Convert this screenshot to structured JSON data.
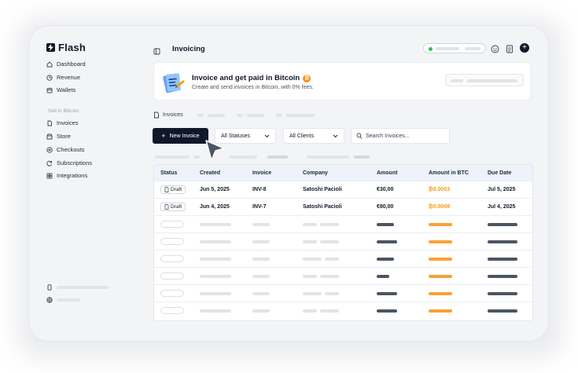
{
  "app": {
    "name": "Flash"
  },
  "sidebar": {
    "items": [
      {
        "label": "Dashboard",
        "icon": "home-icon"
      },
      {
        "label": "Revenue",
        "icon": "clock-icon"
      },
      {
        "label": "Wallets",
        "icon": "wallet-icon"
      }
    ],
    "section_label": "Sell in Bitcoin",
    "sell_items": [
      {
        "label": "Invoices",
        "icon": "invoice-icon"
      },
      {
        "label": "Store",
        "icon": "store-icon"
      },
      {
        "label": "Checkouts",
        "icon": "checkout-icon"
      },
      {
        "label": "Subscriptions",
        "icon": "refresh-icon"
      },
      {
        "label": "Integrations",
        "icon": "grid-icon"
      }
    ]
  },
  "header": {
    "title": "Invoicing"
  },
  "banner": {
    "title": "Invoice and get paid in Bitcoin",
    "subtitle": "Create and send invoices in Bitcoin, with 0% fees.",
    "coin_symbol": "₿"
  },
  "tabs": {
    "active": "Invoices"
  },
  "toolbar": {
    "new_invoice": "New Invoice",
    "status_filter": "All Statuses",
    "client_filter": "All Clients",
    "search_placeholder": "Search Invoices..."
  },
  "table": {
    "columns": [
      "Status",
      "Created",
      "Invoice",
      "Company",
      "Amount",
      "Amount in BTC",
      "Due Date"
    ],
    "rows": [
      {
        "status": "Draft",
        "created": "Jun 5, 2025",
        "invoice": "INV-8",
        "company": "Satoshi Pacioli",
        "amount": "€30,00",
        "btc": "₿0.0003",
        "due": "Jul 5, 2025"
      },
      {
        "status": "Draft",
        "created": "Jun 4, 2025",
        "invoice": "INV-7",
        "company": "Satoshi Pacioli",
        "amount": "€80,00",
        "btc": "₿0.0008",
        "due": "Jul 4, 2025"
      }
    ]
  },
  "colors": {
    "accent": "#0f172a",
    "bitcoin": "#f7931a",
    "btc_text": "#f59e0b",
    "status_online": "#22c55e"
  }
}
